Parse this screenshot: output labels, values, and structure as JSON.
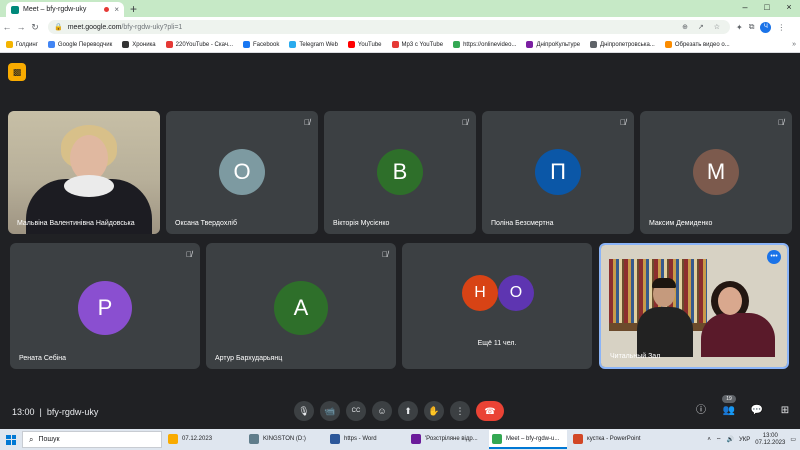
{
  "browser": {
    "tab": {
      "title": "Meet – bfy-rgdw-uky",
      "close": "×"
    },
    "new_tab": "+",
    "window_controls": {
      "minimize": "–",
      "maximize": "□",
      "close": "×"
    },
    "nav": {
      "back": "←",
      "forward": "→",
      "reload": "↻"
    },
    "address": {
      "host": "meet.google.com",
      "path": "/bfy-rgdw-uky?pli=1"
    },
    "profile_initial": "Ч",
    "bookmarks": [
      {
        "label": "Голдинг",
        "color": "#f4b400"
      },
      {
        "label": "Google Переводчик",
        "color": "#4285f4"
      },
      {
        "label": "Хроника",
        "color": "#333333"
      },
      {
        "label": "220YouTube - Скач...",
        "color": "#e53935"
      },
      {
        "label": "Facebook",
        "color": "#1877f2"
      },
      {
        "label": "Telegram Web",
        "color": "#2aabee"
      },
      {
        "label": "YouTube",
        "color": "#ff0000"
      },
      {
        "label": "Mp3 с YouTube",
        "color": "#e53935"
      },
      {
        "label": "https://onlinevideo...",
        "color": "#34a853"
      },
      {
        "label": "ДніпроКультуре",
        "color": "#7b1fa2"
      },
      {
        "label": "Дніпропетровська...",
        "color": "#5f6368"
      },
      {
        "label": "Обрезать видео о...",
        "color": "#fb8c00"
      }
    ]
  },
  "meet": {
    "tiles_row1": [
      {
        "name": "Мальвіна Валентинівна Найдовська",
        "type": "video"
      },
      {
        "name": "Оксана Твердохліб",
        "initial": "О",
        "color": "#7d9aa1",
        "muted": true
      },
      {
        "name": "Вікторія Мусієнко",
        "initial": "В",
        "color": "#2e6f2a",
        "muted": true
      },
      {
        "name": "Поліна Безсмертна",
        "initial": "П",
        "color": "#0b57a7",
        "muted": true
      },
      {
        "name": "Максим Демиденко",
        "initial": "М",
        "color": "#7c5a4d",
        "muted": true
      }
    ],
    "tiles_row2": [
      {
        "name": "Рената Себіна",
        "initial": "Р",
        "color": "#8a4fd0",
        "muted": true
      },
      {
        "name": "Артур Бархударьянц",
        "initial": "А",
        "color": "#2e6f2a",
        "muted": true
      }
    ],
    "others": {
      "initials": [
        "Н",
        "О"
      ],
      "colors": [
        "#d84315",
        "#5e35b1"
      ],
      "label": "Ещё 11 чел."
    },
    "library": {
      "name": "Читальный Зал"
    },
    "time": "13:00",
    "separator": "|",
    "meeting_code": "bfy-rgdw-uky",
    "participants_count": "19",
    "controls": {
      "mic": "🎙",
      "camera": "📹",
      "captions": "CC",
      "emoji": "☺",
      "present": "⬆",
      "hand": "✋",
      "more": "⋮",
      "end": "☎"
    },
    "right_controls": {
      "info": "ⓘ",
      "people": "👥",
      "chat": "💬",
      "activities": "⊞"
    }
  },
  "taskbar": {
    "search_label": "Пошук",
    "items": [
      {
        "label": "07.12.2023",
        "color": "#f9ab00",
        "active": false
      },
      {
        "label": "KINGSTON (D:)",
        "color": "#607d8b",
        "active": false
      },
      {
        "label": "https - Word",
        "color": "#2b579a",
        "active": false
      },
      {
        "label": "'Розстріляне відр...",
        "color": "#6a1b9a",
        "active": false
      },
      {
        "label": "Meet – bfy-rgdw-u...",
        "color": "#34a853",
        "active": true
      },
      {
        "label": "кустка - PowerPoint",
        "color": "#d24726",
        "active": false
      }
    ],
    "lang": "УКР",
    "clock_time": "13:00",
    "clock_date": "07.12.2023"
  }
}
